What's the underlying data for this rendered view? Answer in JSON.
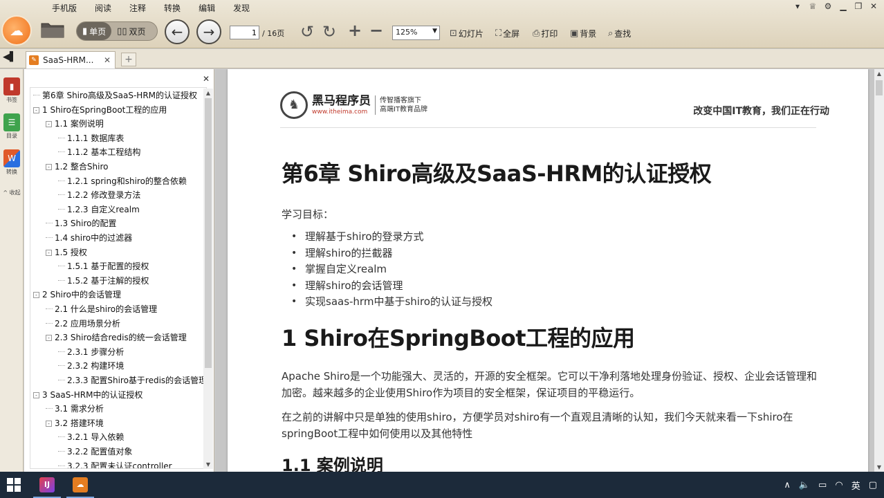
{
  "menu": [
    "手机版",
    "阅读",
    "注释",
    "转换",
    "编辑",
    "发现"
  ],
  "toolbar": {
    "single_page": "单页",
    "double_page": "双页",
    "current_page": "1",
    "total_pages": "/ 16页",
    "zoom": "125%",
    "slideshow": "幻灯片",
    "fullscreen": "全屏",
    "print": "打印",
    "background": "背景",
    "find": "查找"
  },
  "tab": {
    "label": "SaaS-HRM..."
  },
  "rail": [
    {
      "label": "书签",
      "icon": "bookmark-icon",
      "color": "#c0392b"
    },
    {
      "label": "目录",
      "icon": "contents-icon",
      "color": "#3fa34d"
    },
    {
      "label": "转换",
      "icon": "convert-icon",
      "color": "#e05a2a"
    },
    {
      "label": "收起",
      "icon": "collapse-icon",
      "color": ""
    }
  ],
  "outline": [
    {
      "level": 0,
      "toggle": "",
      "text": "第6章 Shiro高级及SaaS-HRM的认证授权"
    },
    {
      "level": 0,
      "toggle": "-",
      "text": "1 Shiro在SpringBoot工程的应用"
    },
    {
      "level": 1,
      "toggle": "-",
      "text": "1.1 案例说明"
    },
    {
      "level": 2,
      "toggle": "",
      "text": "1.1.1 数据库表"
    },
    {
      "level": 2,
      "toggle": "",
      "text": "1.1.2 基本工程结构"
    },
    {
      "level": 1,
      "toggle": "-",
      "text": "1.2 整合Shiro"
    },
    {
      "level": 2,
      "toggle": "",
      "text": "1.2.1 spring和shiro的整合依赖"
    },
    {
      "level": 2,
      "toggle": "",
      "text": "1.2.2 修改登录方法"
    },
    {
      "level": 2,
      "toggle": "",
      "text": "1.2.3 自定义realm"
    },
    {
      "level": 1,
      "toggle": "",
      "text": "1.3 Shiro的配置"
    },
    {
      "level": 1,
      "toggle": "",
      "text": "1.4 shiro中的过滤器"
    },
    {
      "level": 1,
      "toggle": "-",
      "text": "1.5 授权"
    },
    {
      "level": 2,
      "toggle": "",
      "text": "1.5.1 基于配置的授权"
    },
    {
      "level": 2,
      "toggle": "",
      "text": "1.5.2 基于注解的授权"
    },
    {
      "level": 0,
      "toggle": "-",
      "text": "2 Shiro中的会话管理"
    },
    {
      "level": 1,
      "toggle": "",
      "text": "2.1 什么是shiro的会话管理"
    },
    {
      "level": 1,
      "toggle": "",
      "text": "2.2 应用场景分析"
    },
    {
      "level": 1,
      "toggle": "-",
      "text": "2.3 Shiro结合redis的统一会话管理"
    },
    {
      "level": 2,
      "toggle": "",
      "text": "2.3.1 步骤分析"
    },
    {
      "level": 2,
      "toggle": "",
      "text": "2.3.2 构建环境"
    },
    {
      "level": 2,
      "toggle": "",
      "text": "2.3.3 配置Shiro基于redis的会话管理"
    },
    {
      "level": 0,
      "toggle": "-",
      "text": "3 SaaS-HRM中的认证授权"
    },
    {
      "level": 1,
      "toggle": "",
      "text": "3.1 需求分析"
    },
    {
      "level": 1,
      "toggle": "-",
      "text": "3.2 搭建环境"
    },
    {
      "level": 2,
      "toggle": "",
      "text": "3.2.1 导入依赖"
    },
    {
      "level": 2,
      "toggle": "",
      "text": "3.2.2 配置值对象"
    },
    {
      "level": 2,
      "toggle": "",
      "text": "3.2.3 配置未认证controller"
    }
  ],
  "doc": {
    "brand_name": "黑马程序员",
    "brand_url": "www.itheima.com",
    "brand_slogan_1": "传智播客旗下",
    "brand_slogan_2": "高端IT教育品牌",
    "motto": "改变中国IT教育，我们正在行动",
    "chapter_title": "第6章 Shiro高级及SaaS-HRM的认证授权",
    "goal_label": "学习目标：",
    "goals": [
      "理解基于shiro的登录方式",
      "理解shiro的拦截器",
      "掌握自定义realm",
      "理解shiro的会话管理",
      "实现saas-hrm中基于shiro的认证与授权"
    ],
    "section_title": "1 Shiro在SpringBoot工程的应用",
    "para1": "Apache Shiro是一个功能强大、灵活的，开源的安全框架。它可以干净利落地处理身份验证、授权、企业会话管理和加密。越来越多的企业使用Shiro作为项目的安全框架，保证项目的平稳运行。",
    "para2": "在之前的讲解中只是单独的使用shiro，方便学员对shiro有一个直观且清晰的认知，我们今天就来看一下shiro在springBoot工程中如何使用以及其他特性",
    "subsection_title": "1.1 案例说明"
  },
  "tray": {
    "ime": "英"
  },
  "colors": {
    "accent": "#e47d21",
    "toolbar_bg": "#e4dcc8",
    "taskbar_bg": "#1c2a3a"
  }
}
